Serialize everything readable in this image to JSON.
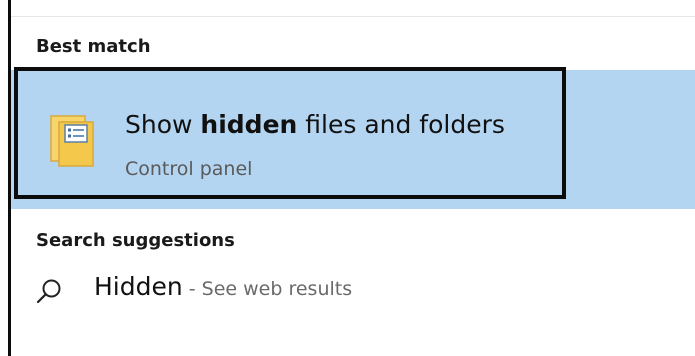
{
  "best_match": {
    "heading": "Best match",
    "result": {
      "title_prefix": "Show ",
      "title_bold": "hidden",
      "title_suffix": " files and folders",
      "subtitle": "Control panel",
      "icon": "folder-options-icon"
    }
  },
  "suggestions": {
    "heading": "Search suggestions",
    "items": [
      {
        "term": "Hidden",
        "separator": " - ",
        "hint": "See web results",
        "icon": "search-icon"
      }
    ]
  },
  "colors": {
    "selection": "#b4d5f1",
    "highlight_border": "#0c0c0c",
    "folder": "#f6cf5c"
  }
}
